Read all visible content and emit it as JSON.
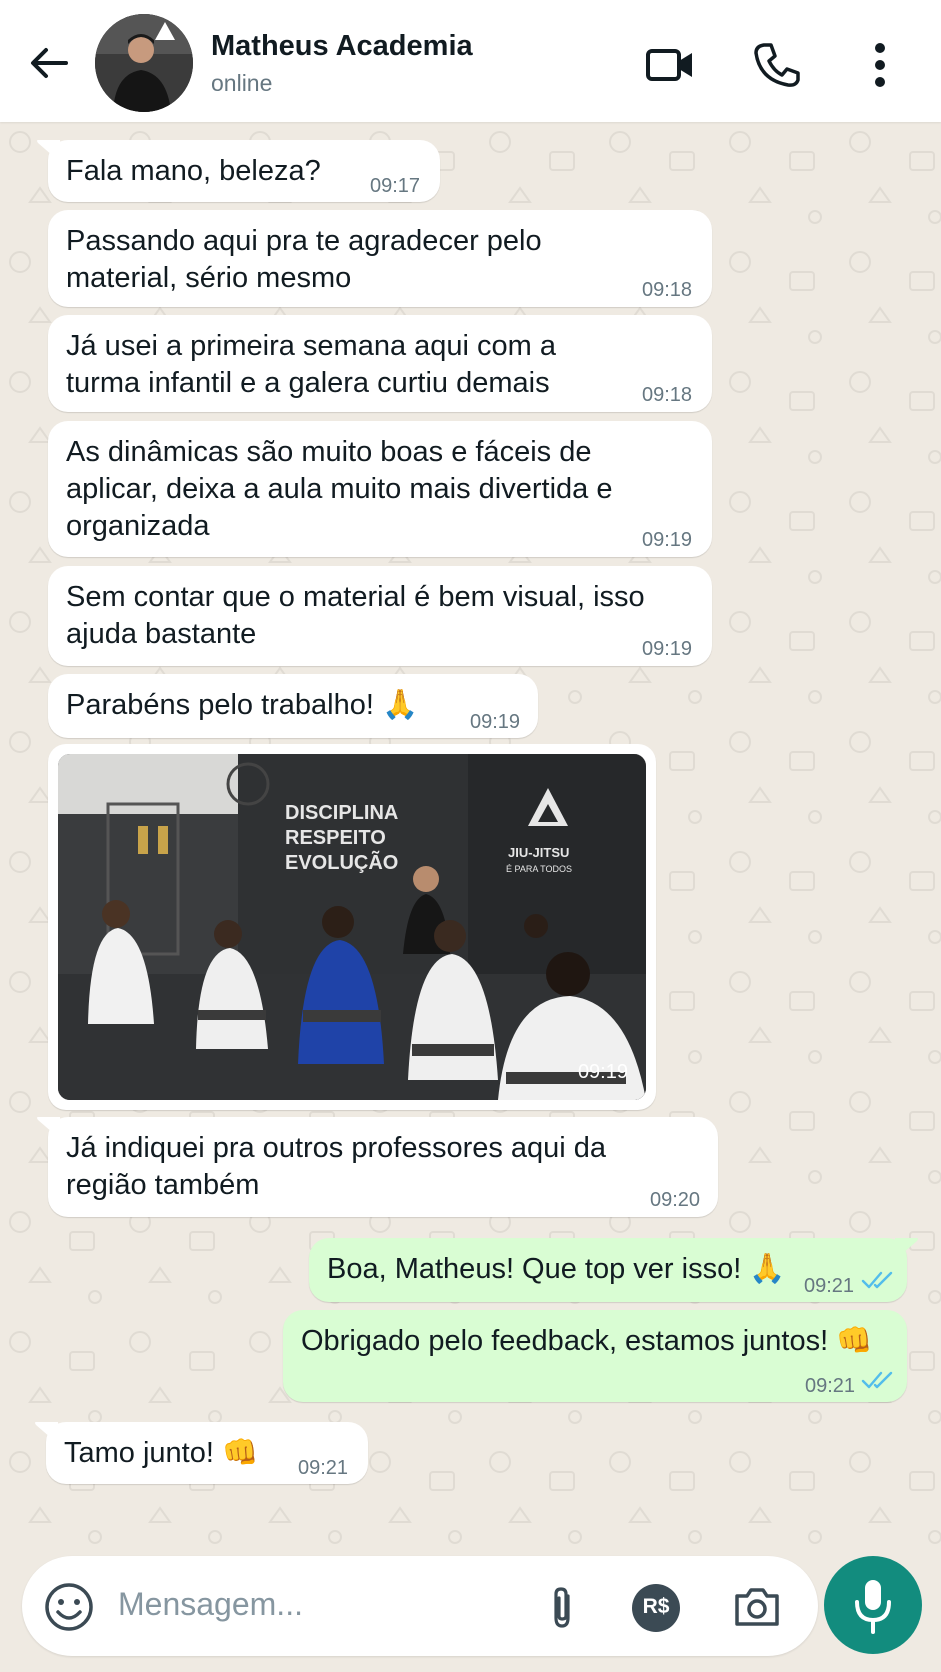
{
  "header": {
    "contact_name": "Matheus Academia",
    "status": "online"
  },
  "messages": [
    {
      "dir": "in",
      "text": "Fala mano, beleza?",
      "time": "09:17"
    },
    {
      "dir": "in",
      "text": "Passando aqui pra te agradecer pelo\nmaterial, sério mesmo",
      "time": "09:18"
    },
    {
      "dir": "in",
      "text": "Já usei a primeira semana aqui com a\nturma infantil e a galera curtiu demais",
      "time": "09:18"
    },
    {
      "dir": "in",
      "text": "As dinâmicas são muito boas e fáceis de\naplicar, deixa a aula muito mais divertida e\norganizada",
      "time": "09:19"
    },
    {
      "dir": "in",
      "text": "Sem contar que o material é bem visual, isso\najuda bastante",
      "time": "09:19"
    },
    {
      "dir": "in",
      "text": "Parabéns pelo trabalho! 🙏",
      "time": "09:19"
    },
    {
      "dir": "in",
      "type": "photo",
      "time": "09:19",
      "photo_text": {
        "wall_left": "DISCIPLINA\nRESPEITO\nEVOLUÇÃO",
        "wall_right_1": "JIU-JITSU",
        "wall_right_2": "É PARA TODOS"
      }
    },
    {
      "dir": "in",
      "text": "Já indiquei pra outros professores aqui da\nregião também",
      "time": "09:20"
    },
    {
      "dir": "out",
      "text": "Boa, Matheus! Que top ver isso! 🙏",
      "time": "09:21",
      "status": "read"
    },
    {
      "dir": "out",
      "text": "Obrigado pelo feedback, estamos juntos! 👊",
      "time": "09:21",
      "status": "read"
    },
    {
      "dir": "in",
      "text": "Tamo junto! 👊",
      "time": "09:21"
    }
  ],
  "input": {
    "placeholder": "Mensagem...",
    "pix_label": "R$"
  },
  "icons": [
    "back-arrow-icon",
    "video-call-icon",
    "phone-icon",
    "more-vert-icon",
    "emoji-icon",
    "attach-icon",
    "pix-icon",
    "camera-icon",
    "mic-icon",
    "read-ticks-icon"
  ],
  "colors": {
    "chat_bg": "#efeae2",
    "incoming": "#ffffff",
    "outgoing": "#d9fdd3",
    "accent": "#128c7e",
    "read_tick": "#53bdeb"
  }
}
